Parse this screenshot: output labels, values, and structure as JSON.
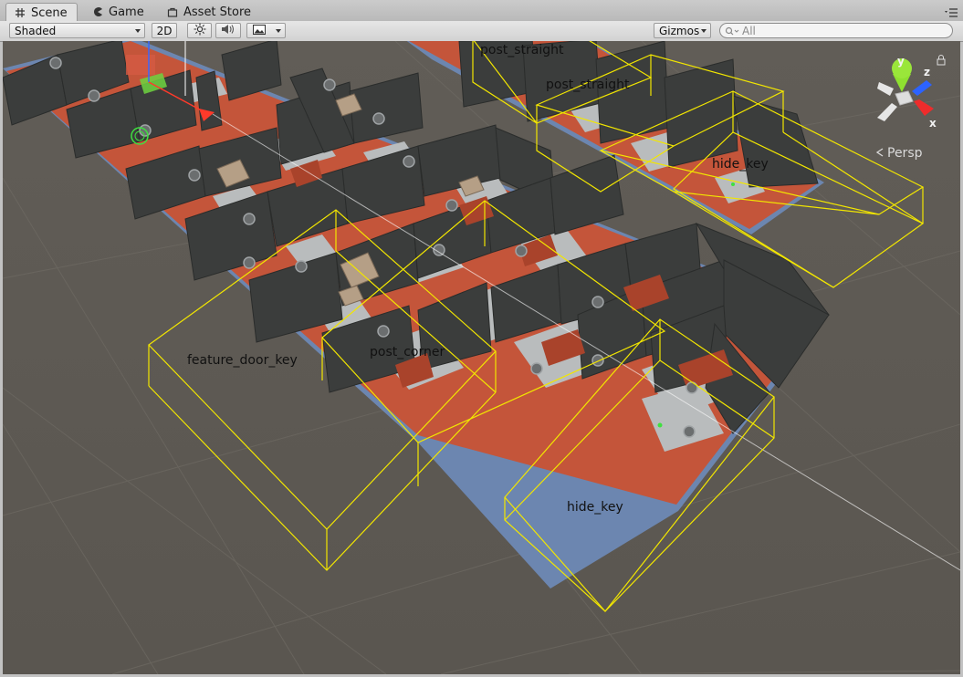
{
  "tabs": [
    {
      "label": "Scene",
      "icon": "grid-icon",
      "active": true
    },
    {
      "label": "Game",
      "icon": "pacman-icon",
      "active": false
    },
    {
      "label": "Asset Store",
      "icon": "bag-icon",
      "active": false
    }
  ],
  "toolbar": {
    "shading_mode": "Shaded",
    "mode_2d": "2D",
    "lighting_icon": "sun-icon",
    "audio_icon": "speaker-icon",
    "effects_icon": "image-icon",
    "gizmos_label": "Gizmos",
    "search_placeholder": "All"
  },
  "scene": {
    "labels": {
      "post_straight_1": "post_straight",
      "post_straight_2": "post_straight",
      "hide_key_1": "hide_key",
      "feature_door_key": "feature_door_key",
      "post_corner": "post_corner",
      "hide_key_2": "hide_key"
    },
    "gizmo": {
      "axis_y": "y",
      "axis_z": "z",
      "axis_x": "x",
      "projection": "Persp"
    },
    "colors": {
      "background": "#5f5b55",
      "floor_red": "#c4553a",
      "wall_dark": "#3b3d3c",
      "selection_yellow": "#f2e600",
      "outline_blue": "#6c86b0"
    }
  }
}
